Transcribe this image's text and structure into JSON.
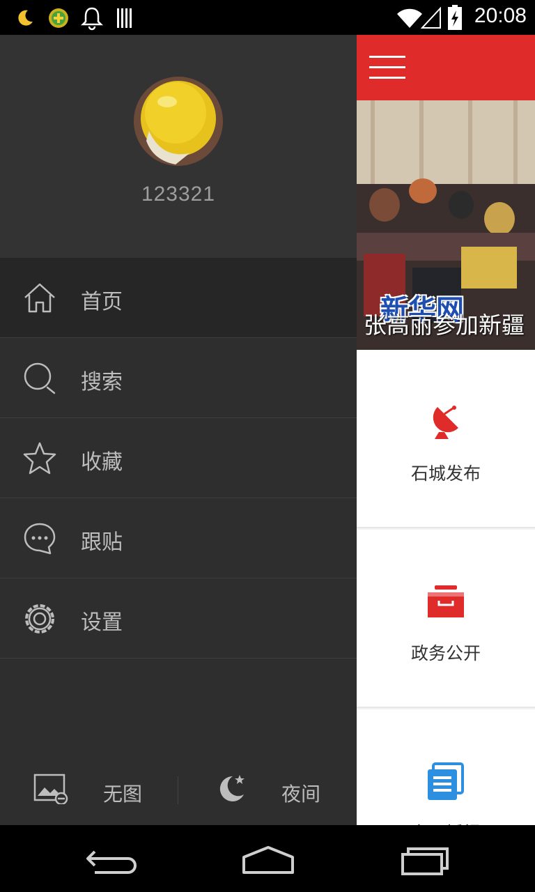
{
  "status_bar": {
    "time": "20:08",
    "left_icons": [
      "moon-icon",
      "app-badge-icon",
      "bell-icon",
      "barcode-icon"
    ],
    "right_icons": [
      "wifi-icon",
      "signal-icon",
      "battery-charging-icon"
    ]
  },
  "drawer": {
    "username": "123321",
    "menu": [
      {
        "label": "首页",
        "icon": "home-icon",
        "active": true
      },
      {
        "label": "搜索",
        "icon": "search-icon",
        "active": false
      },
      {
        "label": "收藏",
        "icon": "star-icon",
        "active": false
      },
      {
        "label": "跟贴",
        "icon": "comment-icon",
        "active": false
      },
      {
        "label": "设置",
        "icon": "gear-icon",
        "active": false
      }
    ],
    "footer": {
      "no_image_label": "无图",
      "night_label": "夜间"
    }
  },
  "main": {
    "banner_title": "张高丽参加新疆",
    "banner_logo": "新华网",
    "tiles": [
      {
        "label": "石城发布",
        "icon": "satellite-dish-icon"
      },
      {
        "label": "政务公开",
        "icon": "inbox-tray-icon"
      },
      {
        "label": "专题播报",
        "icon": "document-list-icon"
      }
    ]
  },
  "colors": {
    "accent_red": "#e02b2b",
    "drawer_bg": "#2e2e2e",
    "tile_blue": "#2d8fe0"
  }
}
